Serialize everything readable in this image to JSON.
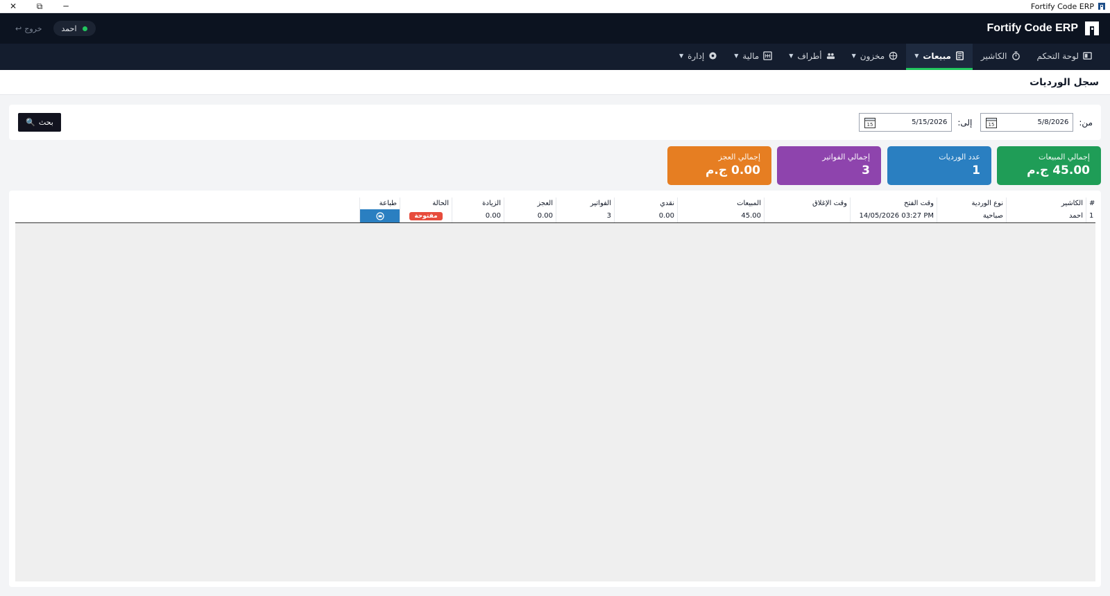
{
  "window": {
    "title": "Fortify Code ERP",
    "close_label": "✕",
    "restore_label": "⧉",
    "minimize_label": "─"
  },
  "header": {
    "brand": "Fortify Code ERP",
    "user_name": "احمد",
    "logout_label": "خروج"
  },
  "nav": {
    "items": [
      {
        "label": "لوحة التحكم",
        "icon": "dashboard-icon"
      },
      {
        "label": "الكاشير",
        "icon": "cashier-icon"
      },
      {
        "label": "مبيعات",
        "icon": "invoice-icon",
        "active": true
      },
      {
        "label": "مخزون",
        "icon": "box-icon"
      },
      {
        "label": "أطراف",
        "icon": "people-icon"
      },
      {
        "label": "مالية",
        "icon": "finance-icon"
      },
      {
        "label": "إدارة",
        "icon": "gear-icon"
      }
    ]
  },
  "page": {
    "title": "سجل الورديات"
  },
  "filters": {
    "from_label": "من:",
    "from_value": "5/8/2026",
    "to_label": "إلى:",
    "to_value": "5/15/2026",
    "search_label": "بحث"
  },
  "kpis": {
    "total_sales": {
      "label": "إجمالي المبيعات",
      "value": "45.00 ج.م"
    },
    "shift_count": {
      "label": "عدد الورديات",
      "value": "1"
    },
    "total_invoices": {
      "label": "إجمالي الفواتير",
      "value": "3"
    },
    "total_deficit": {
      "label": "إجمالي العجز",
      "value": "0.00 ج.م"
    }
  },
  "table": {
    "headers": {
      "num": "#",
      "cashier": "الكاشير",
      "shift_type": "نوع الوردية",
      "open_time": "وقت الفتح",
      "close_time": "وقت الإغلاق",
      "sales": "المبيعات",
      "cash": "نقدي",
      "invoices": "الفواتير",
      "deficit": "العجز",
      "excess": "الزيادة",
      "status": "الحالة",
      "print": "طباعة"
    },
    "rows": [
      {
        "num": "1",
        "cashier": "احمد",
        "shift_type": "صباحية",
        "open_time": "14/05/2026 03:27 PM",
        "close_time": "",
        "sales": "45.00",
        "cash": "0.00",
        "invoices": "3",
        "deficit": "0.00",
        "excess": "0.00",
        "status": "مفتوحة"
      }
    ]
  },
  "colors": {
    "green": "#1f9d57",
    "blue": "#2a7fc1",
    "purple": "#8e44ad",
    "orange": "#e67e22",
    "status_open": "#e74c3c",
    "nav_active_underline": "#22c55e"
  }
}
